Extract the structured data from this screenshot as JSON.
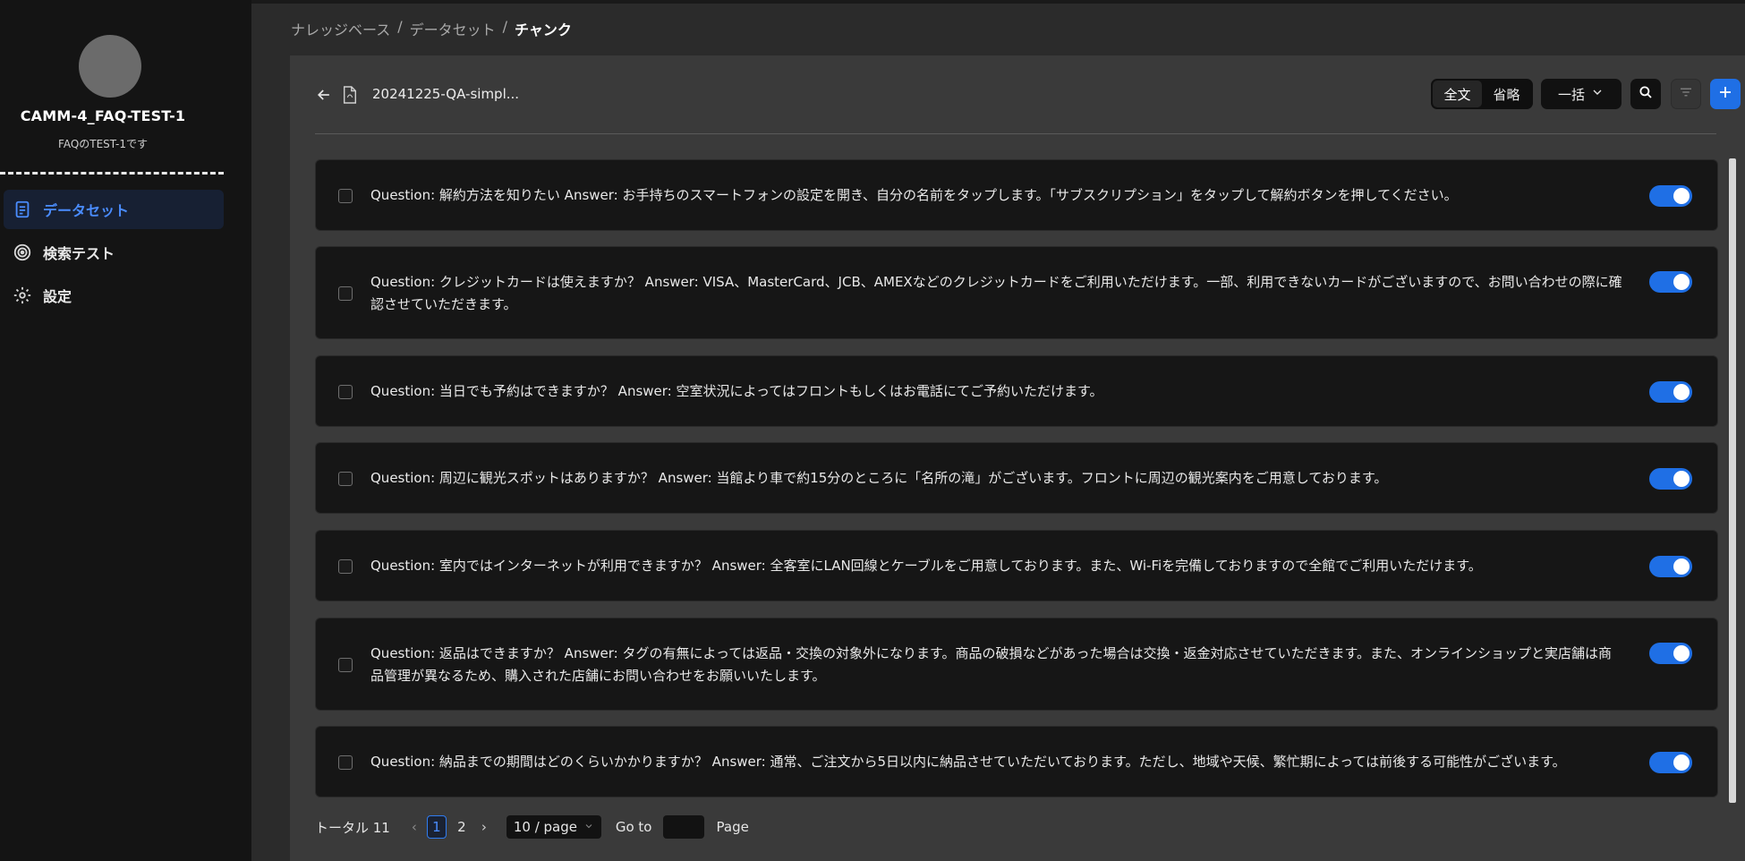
{
  "sidebar": {
    "kb_name": "CAMM-4_FAQ-TEST-1",
    "kb_description": "FAQのTEST-1です",
    "items": [
      {
        "label": "データセット",
        "icon": "document-icon",
        "active": true
      },
      {
        "label": "検索テスト",
        "icon": "target-icon",
        "active": false
      },
      {
        "label": "設定",
        "icon": "gear-icon",
        "active": false
      }
    ]
  },
  "breadcrumb": {
    "level1": "ナレッジベース",
    "level2": "データセット",
    "current": "チャンク",
    "separator": "/"
  },
  "toolbar": {
    "doc_title": "20241225-QA-simpl...",
    "view_full": "全文",
    "view_short": "省略",
    "bulk_label": "一括",
    "accent": "#1f6fe5"
  },
  "chunks": [
    {
      "text": "Question: 解約方法を知りたい Answer: お手持ちのスマートフォンの設定を開き、自分の名前をタップします。「サブスクリプション」をタップして解約ボタンを押してください。",
      "enabled": true
    },
    {
      "text": "Question: クレジットカードは使えますか？ Answer: VISA、MasterCard、JCB、AMEXなどのクレジットカードをご利用いただけます。一部、利用できないカードがございますので、お問い合わせの際に確認させていただきます。",
      "enabled": true
    },
    {
      "text": "Question: 当日でも予約はできますか？ Answer: 空室状況によってはフロントもしくはお電話にてご予約いただけます。",
      "enabled": true
    },
    {
      "text": "Question: 周辺に観光スポットはありますか？ Answer: 当館より車で約15分のところに「名所の滝」がございます。フロントに周辺の観光案内をご用意しております。",
      "enabled": true
    },
    {
      "text": "Question: 室内ではインターネットが利用できますか？ Answer: 全客室にLAN回線とケーブルをご用意しております。また、Wi-Fiを完備しておりますので全館でご利用いただけます。",
      "enabled": true
    },
    {
      "text": "Question: 返品はできますか？ Answer: タグの有無によっては返品・交換の対象外になります。商品の破損などがあった場合は交換・返金対応させていただきます。また、オンラインショップと実店舗は商品管理が異なるため、購入された店舗にお問い合わせをお願いいたします。",
      "enabled": true
    },
    {
      "text": "Question: 納品までの期間はどのくらいかかりますか？ Answer: 通常、ご注文から5日以内に納品させていただいております。ただし、地域や天候、繁忙期によっては前後する可能性がございます。",
      "enabled": true
    }
  ],
  "pagination": {
    "total_label": "トータル 11",
    "pages": [
      "1",
      "2"
    ],
    "current_page": "1",
    "page_size": "10 / page",
    "goto_label": "Go to",
    "page_label": "Page",
    "goto_value": ""
  }
}
